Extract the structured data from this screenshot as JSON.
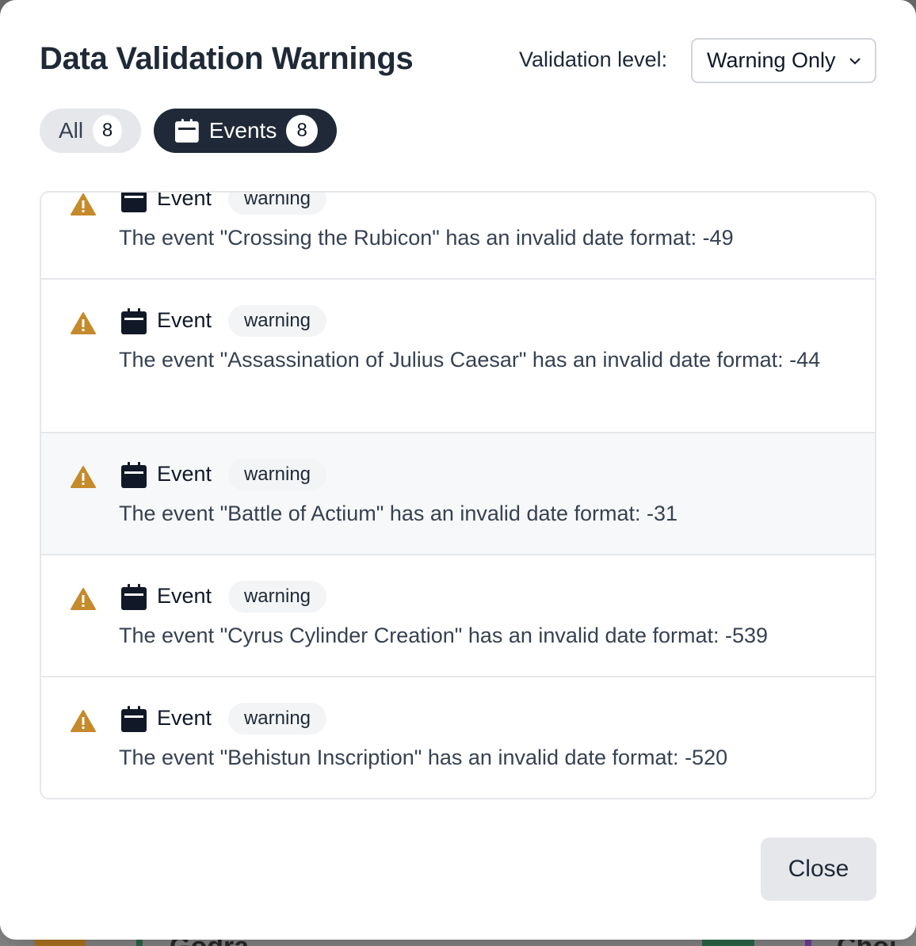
{
  "modal": {
    "title": "Data Validation Warnings",
    "validation_level_label": "Validation level:",
    "validation_level_value": "Warning Only",
    "filters": [
      {
        "label": "All",
        "count": "8"
      },
      {
        "label": "Events",
        "count": "8"
      }
    ],
    "warnings": [
      {
        "kind": "Event",
        "severity": "warning",
        "message": "The event \"Crossing the Rubicon\" has an invalid date format: -49"
      },
      {
        "kind": "Event",
        "severity": "warning",
        "message": "The event \"Assassination of Julius Caesar\" has an invalid date format: -44"
      },
      {
        "kind": "Event",
        "severity": "warning",
        "message": "The event \"Battle of Actium\" has an invalid date format: -31"
      },
      {
        "kind": "Event",
        "severity": "warning",
        "message": "The event \"Cyrus Cylinder Creation\" has an invalid date format: -539"
      },
      {
        "kind": "Event",
        "severity": "warning",
        "message": "The event \"Behistun Inscription\" has an invalid date format: -520"
      }
    ],
    "close_label": "Close"
  },
  "background": {
    "fragment_left": "Gödra",
    "fragment_right": "Choi"
  },
  "colors": {
    "warning_icon": "#c58a2b",
    "active_pill": "#1f2937"
  }
}
